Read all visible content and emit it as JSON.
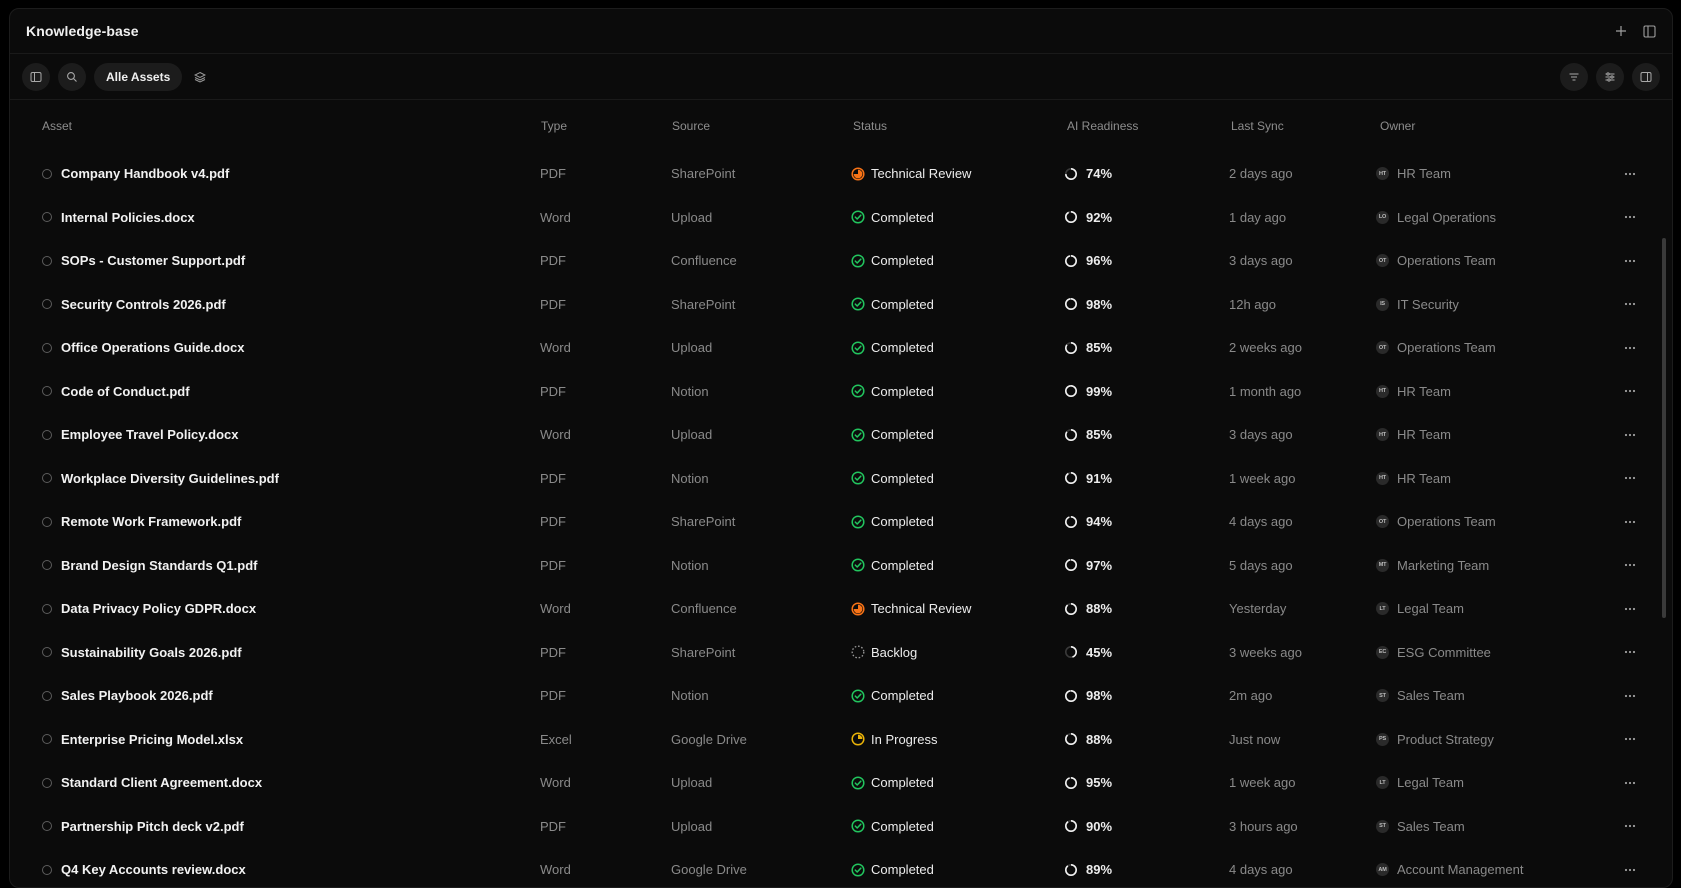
{
  "window": {
    "title": "Knowledge-base"
  },
  "toolbar": {
    "filter_label": "Alle Assets"
  },
  "columns": {
    "asset": "Asset",
    "type": "Type",
    "source": "Source",
    "status": "Status",
    "ai": "AI Readiness",
    "sync": "Last Sync",
    "owner": "Owner"
  },
  "colors": {
    "completed": "#22c55e",
    "technical_review": "#f97316",
    "in_progress": "#eab308",
    "backlog": "#9a9a9a"
  },
  "rows": [
    {
      "name": "Company Handbook v4.pdf",
      "type": "PDF",
      "source": "SharePoint",
      "status": "Technical Review",
      "status_kind": "technical_review",
      "ai": "74%",
      "ai_value": 74,
      "sync": "2 days ago",
      "owner_initials": "HT",
      "owner": "HR Team"
    },
    {
      "name": "Internal Policies.docx",
      "type": "Word",
      "source": "Upload",
      "status": "Completed",
      "status_kind": "completed",
      "ai": "92%",
      "ai_value": 92,
      "sync": "1 day ago",
      "owner_initials": "LO",
      "owner": "Legal Operations"
    },
    {
      "name": "SOPs - Customer Support.pdf",
      "type": "PDF",
      "source": "Confluence",
      "status": "Completed",
      "status_kind": "completed",
      "ai": "96%",
      "ai_value": 96,
      "sync": "3 days ago",
      "owner_initials": "OT",
      "owner": "Operations Team"
    },
    {
      "name": "Security Controls 2026.pdf",
      "type": "PDF",
      "source": "SharePoint",
      "status": "Completed",
      "status_kind": "completed",
      "ai": "98%",
      "ai_value": 98,
      "sync": "12h ago",
      "owner_initials": "IS",
      "owner": "IT Security"
    },
    {
      "name": "Office Operations Guide.docx",
      "type": "Word",
      "source": "Upload",
      "status": "Completed",
      "status_kind": "completed",
      "ai": "85%",
      "ai_value": 85,
      "sync": "2 weeks ago",
      "owner_initials": "OT",
      "owner": "Operations Team"
    },
    {
      "name": "Code of Conduct.pdf",
      "type": "PDF",
      "source": "Notion",
      "status": "Completed",
      "status_kind": "completed",
      "ai": "99%",
      "ai_value": 99,
      "sync": "1 month ago",
      "owner_initials": "HT",
      "owner": "HR Team"
    },
    {
      "name": "Employee Travel Policy.docx",
      "type": "Word",
      "source": "Upload",
      "status": "Completed",
      "status_kind": "completed",
      "ai": "85%",
      "ai_value": 85,
      "sync": "3 days ago",
      "owner_initials": "HT",
      "owner": "HR Team"
    },
    {
      "name": "Workplace Diversity Guidelines.pdf",
      "type": "PDF",
      "source": "Notion",
      "status": "Completed",
      "status_kind": "completed",
      "ai": "91%",
      "ai_value": 91,
      "sync": "1 week ago",
      "owner_initials": "HT",
      "owner": "HR Team"
    },
    {
      "name": "Remote Work Framework.pdf",
      "type": "PDF",
      "source": "SharePoint",
      "status": "Completed",
      "status_kind": "completed",
      "ai": "94%",
      "ai_value": 94,
      "sync": "4 days ago",
      "owner_initials": "OT",
      "owner": "Operations Team"
    },
    {
      "name": "Brand Design Standards Q1.pdf",
      "type": "PDF",
      "source": "Notion",
      "status": "Completed",
      "status_kind": "completed",
      "ai": "97%",
      "ai_value": 97,
      "sync": "5 days ago",
      "owner_initials": "MT",
      "owner": "Marketing Team"
    },
    {
      "name": "Data Privacy Policy GDPR.docx",
      "type": "Word",
      "source": "Confluence",
      "status": "Technical Review",
      "status_kind": "technical_review",
      "ai": "88%",
      "ai_value": 88,
      "sync": "Yesterday",
      "owner_initials": "LT",
      "owner": "Legal Team"
    },
    {
      "name": "Sustainability Goals 2026.pdf",
      "type": "PDF",
      "source": "SharePoint",
      "status": "Backlog",
      "status_kind": "backlog",
      "ai": "45%",
      "ai_value": 45,
      "sync": "3 weeks ago",
      "owner_initials": "EC",
      "owner": "ESG Committee"
    },
    {
      "name": "Sales Playbook 2026.pdf",
      "type": "PDF",
      "source": "Notion",
      "status": "Completed",
      "status_kind": "completed",
      "ai": "98%",
      "ai_value": 98,
      "sync": "2m ago",
      "owner_initials": "ST",
      "owner": "Sales Team"
    },
    {
      "name": "Enterprise Pricing Model.xlsx",
      "type": "Excel",
      "source": "Google Drive",
      "status": "In Progress",
      "status_kind": "in_progress",
      "ai": "88%",
      "ai_value": 88,
      "sync": "Just now",
      "owner_initials": "PS",
      "owner": "Product Strategy"
    },
    {
      "name": "Standard Client Agreement.docx",
      "type": "Word",
      "source": "Upload",
      "status": "Completed",
      "status_kind": "completed",
      "ai": "95%",
      "ai_value": 95,
      "sync": "1 week ago",
      "owner_initials": "LT",
      "owner": "Legal Team"
    },
    {
      "name": "Partnership Pitch deck v2.pdf",
      "type": "PDF",
      "source": "Upload",
      "status": "Completed",
      "status_kind": "completed",
      "ai": "90%",
      "ai_value": 90,
      "sync": "3 hours ago",
      "owner_initials": "ST",
      "owner": "Sales Team"
    },
    {
      "name": "Q4 Key Accounts review.docx",
      "type": "Word",
      "source": "Google Drive",
      "status": "Completed",
      "status_kind": "completed",
      "ai": "89%",
      "ai_value": 89,
      "sync": "4 days ago",
      "owner_initials": "AM",
      "owner": "Account Management"
    }
  ]
}
